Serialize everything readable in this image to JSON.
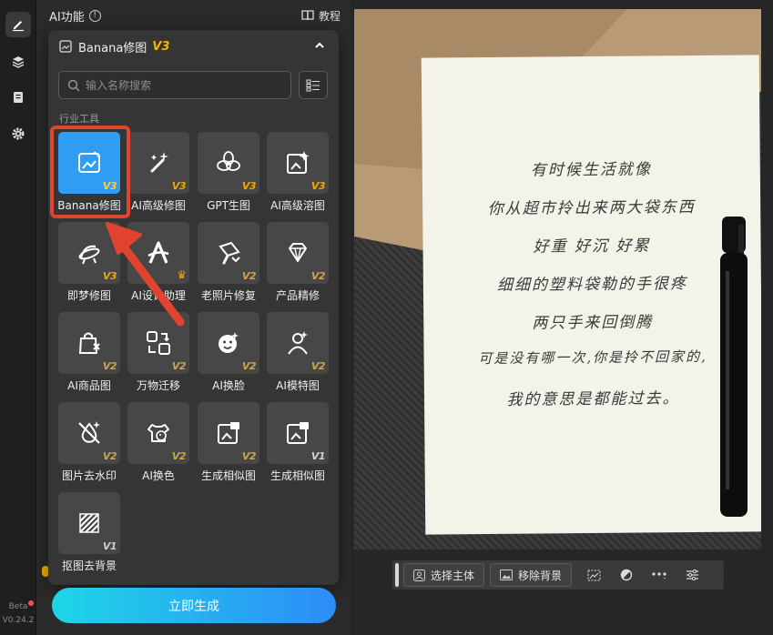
{
  "panel": {
    "title": "AI功能",
    "help_label": "教程"
  },
  "popup": {
    "title": "Banana修图",
    "version": "V3",
    "search_placeholder": "输入名称搜索",
    "section": "行业工具",
    "tools": [
      {
        "label": "Banana修图",
        "badge": "V3",
        "icon": "image-edit-icon"
      },
      {
        "label": "AI高级修图",
        "badge": "V3",
        "icon": "magic-wand-icon"
      },
      {
        "label": "GPT生图",
        "badge": "V3",
        "icon": "openai-icon"
      },
      {
        "label": "AI高级溶图",
        "badge": "V3",
        "icon": "image-sparkle-icon"
      },
      {
        "label": "即梦修图",
        "badge": "V3",
        "icon": "dream-icon"
      },
      {
        "label": "AI设计助理",
        "badge": "",
        "icon": "design-a-icon"
      },
      {
        "label": "老照片修复",
        "badge": "V2",
        "icon": "brush-icon"
      },
      {
        "label": "产品精修",
        "badge": "V2",
        "icon": "diamond-icon"
      },
      {
        "label": "AI商品图",
        "badge": "V2",
        "icon": "shopping-bag-icon"
      },
      {
        "label": "万物迁移",
        "badge": "V2",
        "icon": "transfer-icon"
      },
      {
        "label": "AI换脸",
        "badge": "V2",
        "icon": "face-icon"
      },
      {
        "label": "AI模特图",
        "badge": "V2",
        "icon": "model-icon"
      },
      {
        "label": "图片去水印",
        "badge": "V2",
        "icon": "watermark-remove-icon"
      },
      {
        "label": "AI换色",
        "badge": "V2",
        "icon": "palette-shirt-icon"
      },
      {
        "label": "生成相似图",
        "badge": "V2",
        "icon": "similar-image-icon"
      },
      {
        "label": "生成相似图",
        "badge": "V1",
        "icon": "similar-image-icon"
      },
      {
        "label": "抠图去背景",
        "badge": "V1",
        "icon": "cutout-icon"
      }
    ]
  },
  "generate_label": "立即生成",
  "rail": {
    "beta": "Beta",
    "version": "V0.24.2"
  },
  "photo": {
    "lines": [
      "有时候生活就像",
      "你从超市拎出来两大袋东西",
      "好重 好沉 好累",
      "细细的塑料袋勒的手很疼",
      "两只手来回倒腾",
      "可是没有哪一次,你是拎不回家的,",
      "我的意思是都能过去。"
    ]
  },
  "toolbar": {
    "select_subject": "选择主体",
    "remove_bg": "移除背景"
  },
  "colors": {
    "accent": "#2f9df4",
    "highlight": "#e0432f",
    "version_badge": "#f0a500"
  }
}
